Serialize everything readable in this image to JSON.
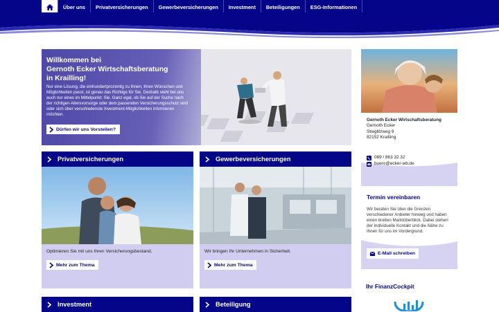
{
  "nav": {
    "items": [
      "Über uns",
      "Privatversicherungen",
      "Gewerbeversicherungen",
      "Investment",
      "Beteiligungen",
      "ESG-Informationen"
    ]
  },
  "hero": {
    "title_line1": "Willkommen bei",
    "title_line2": "Gernoth Ecker Wirtschaftsberatung",
    "title_line3": "in Krailling!",
    "text": "Nur eine Lösung, die einhundertprozentig zu Ihnen, Ihren Wünschen und Möglichkeiten passt, ist genau das Richtige für Sie. Deshalb steht bei uns auch nur eines im Mittelpunkt: Sie. Ganz egal, ob Sie auf der Suche nach der richtigen Altersvorsorge oder dem passenden Versicherungsschutz sind oder sich über verschiedenste Investment-Möglichkeiten informieren möchten.",
    "button": "Dürfen wir uns Vorstellen?"
  },
  "cards": [
    {
      "title": "Privatversicherungen",
      "text": "Optimieren Sie mit uns Ihren Versicherungsbestand.",
      "button": "Mehr zum Thema"
    },
    {
      "title": "Gewerbeversicherungen",
      "text": "Wir bringen Ihr Unternehmen in Sicherheit.",
      "button": "Mehr zum Thema"
    },
    {
      "title": "Investment"
    },
    {
      "title": "Beteiligung"
    }
  ],
  "contact": {
    "company": "Gernoth Ecker Wirtschaftsberatung",
    "person": "Gernoth Ecker",
    "street": "Stieglitzweg 9",
    "city": "82152 Krailling",
    "phone": "089 / 863 32 32",
    "email": "buero@ecker-wb.de"
  },
  "termin": {
    "title": "Termin vereinbaren",
    "text": "Wir beraten Sie über die Grenzen verschiedener Anbieter hinweg und haben einen breiten Marktüberblick. Dabei stehen der individuelle Kontakt und die Nähe zu Ihnen für uns im Vordergrund.",
    "button": "E-Mail schreiben"
  },
  "finanzcockpit": {
    "title": "Ihr FinanzCockpit"
  },
  "colors": {
    "brand": "#05058a",
    "card_bg": "#d0cdf0",
    "hero_start": "#4d47a6"
  },
  "icons": {
    "home": "home-icon",
    "chevron": "chevron-right-icon",
    "phone": "phone-icon",
    "mail": "mail-icon"
  }
}
